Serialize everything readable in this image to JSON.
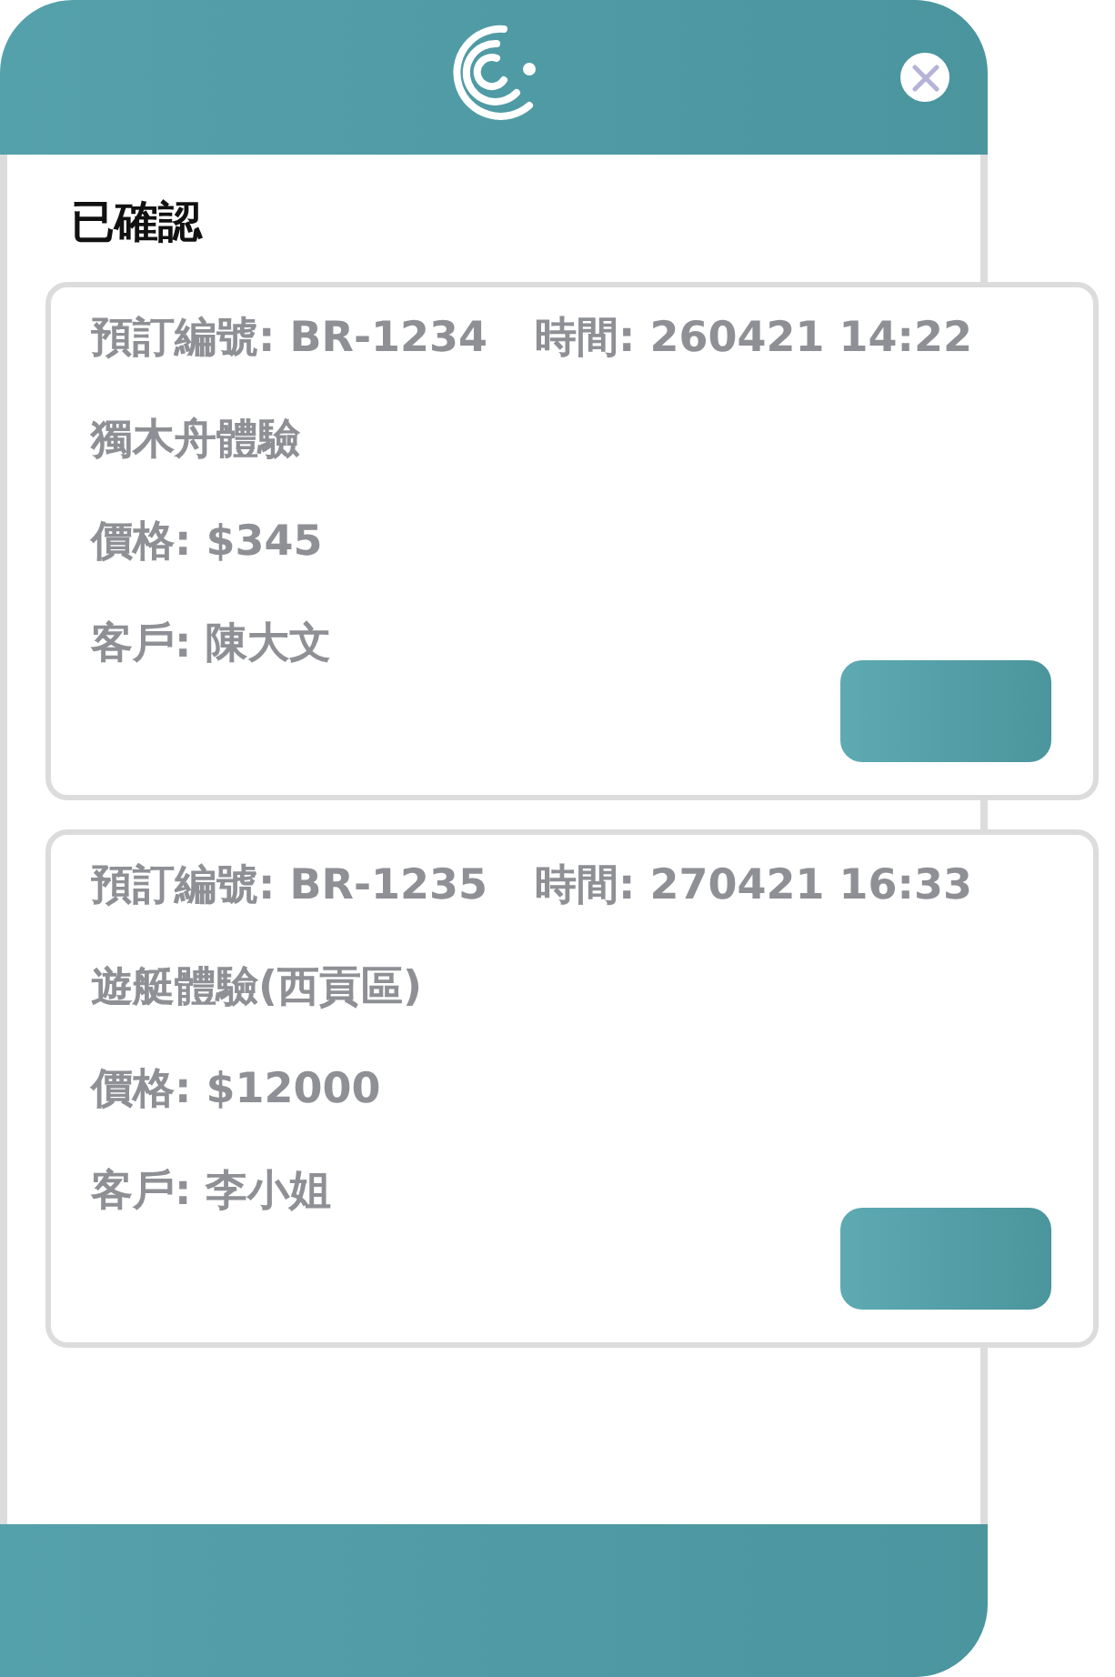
{
  "section_title": "已確認",
  "bookings": [
    {
      "booking_no": "預訂編號: BR-1234",
      "time": "時間: 260421 14:22",
      "activity": "獨木舟體驗",
      "price": "價格: $345",
      "customer": "客戶: 陳大文"
    },
    {
      "booking_no": "預訂編號: BR-1235",
      "time": "時間: 270421 16:33",
      "activity": "遊艇體驗(西貢區)",
      "price": "價格: $12000",
      "customer": "客戶: 李小姐"
    }
  ]
}
